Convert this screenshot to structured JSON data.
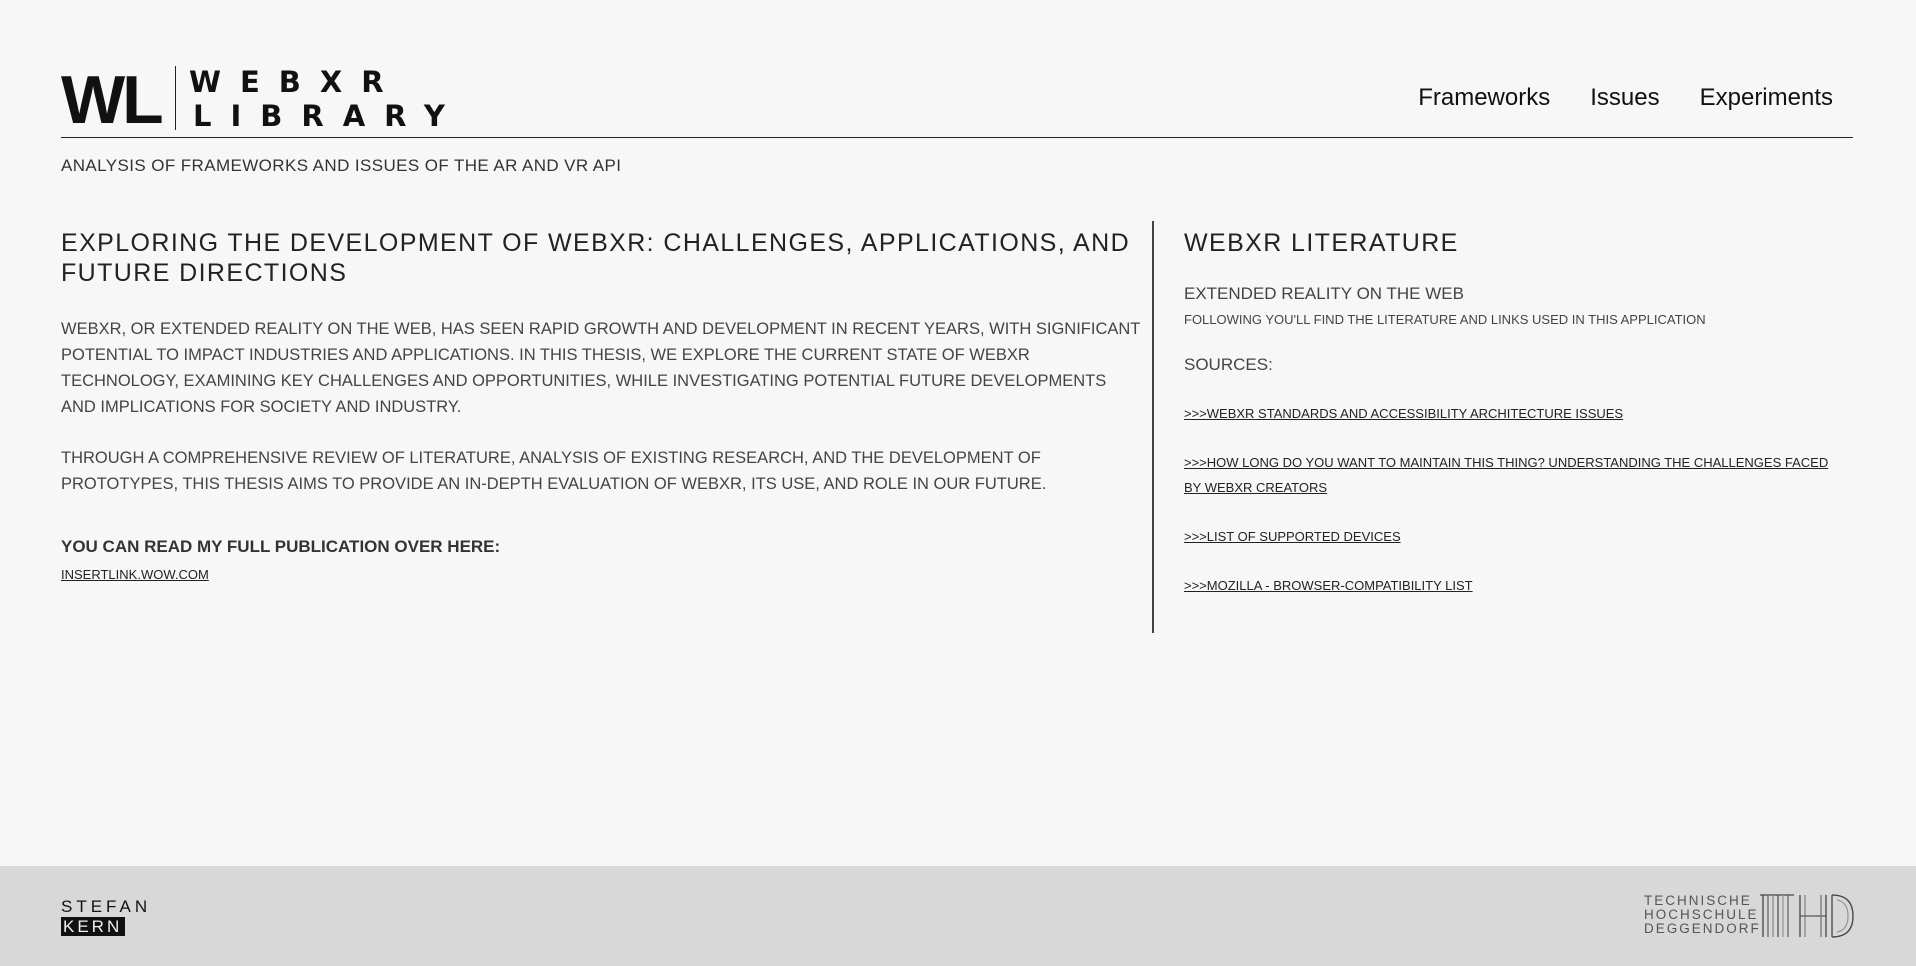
{
  "logo": {
    "mark": "WL",
    "line1": "WEBXR",
    "line2": "LIBRARY"
  },
  "nav": [
    "Frameworks",
    "Issues",
    "Experiments"
  ],
  "tagline": "ANALYSIS OF FRAMEWORKS AND ISSUES OF THE AR AND VR API",
  "main": {
    "title": "EXPLORING THE DEVELOPMENT OF WEBXR: CHALLENGES, APPLICATIONS, AND FUTURE DIRECTIONS",
    "paragraphs": [
      "WEBXR, OR EXTENDED REALITY ON THE WEB, HAS SEEN RAPID GROWTH AND DEVELOPMENT IN RECENT YEARS, WITH SIGNIFICANT POTENTIAL TO IMPACT INDUSTRIES AND APPLICATIONS. IN THIS THESIS, WE EXPLORE THE CURRENT STATE OF WEBXR TECHNOLOGY, EXAMINING KEY CHALLENGES AND OPPORTUNITIES, WHILE INVESTIGATING POTENTIAL FUTURE DEVELOPMENTS AND IMPLICATIONS FOR SOCIETY AND INDUSTRY.",
      "THROUGH A COMPREHENSIVE REVIEW OF LITERATURE, ANALYSIS OF EXISTING RESEARCH, AND THE DEVELOPMENT OF PROTOTYPES, THIS THESIS AIMS TO PROVIDE AN IN-DEPTH EVALUATION OF WEBXR, ITS USE, AND ROLE IN OUR FUTURE."
    ],
    "read_more": "YOU CAN READ MY FULL PUBLICATION OVER HERE:",
    "pub_link": "INSERTLINK.WOW.COM"
  },
  "literature": {
    "title": "WEBXR LITERATURE",
    "subtitle": "EXTENDED REALITY ON THE WEB",
    "description": "FOLLOWING YOU'LL FIND THE LITERATURE AND LINKS USED IN THIS APPLICATION",
    "sources_label": "SOURCES:",
    "sources": [
      ">>>WEBXR STANDARDS AND ACCESSIBILITY ARCHITECTURE ISSUES",
      ">>>HOW LONG DO YOU WANT TO MAINTAIN THIS THING? UNDERSTANDING THE CHALLENGES FACED BY WEBXR CREATORS",
      ">>>LIST OF SUPPORTED DEVICES",
      ">>>MOZILLA - BROWSER-COMPATIBILITY LIST"
    ]
  },
  "footer": {
    "author_first": "STEFAN",
    "author_last": "KERN",
    "institution_lines": [
      "TECHNISCHE",
      "HOCHSCHULE",
      "DEGGENDORF"
    ],
    "institution_mark": "THD"
  }
}
